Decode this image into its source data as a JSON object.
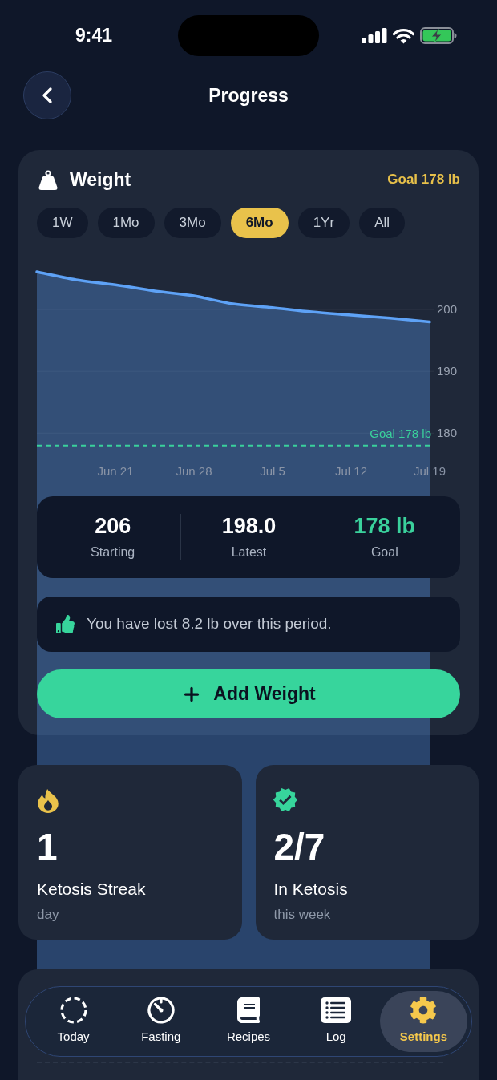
{
  "status_bar": {
    "time": "9:41"
  },
  "header": {
    "title": "Progress"
  },
  "weight_card": {
    "goal": "Goal 178 lb",
    "ranges": [
      {
        "label": "1W",
        "selected": false
      },
      {
        "label": "1Mo",
        "selected": false
      },
      {
        "label": "3Mo",
        "selected": false
      },
      {
        "label": "6Mo",
        "selected": true
      },
      {
        "label": "1Yr",
        "selected": false
      },
      {
        "label": "All",
        "selected": false
      }
    ],
    "chart_data": {
      "type": "area",
      "title": "Weight",
      "categories": [
        null,
        null,
        "Jun 21",
        null,
        "Jun 28",
        null,
        "Jul 5",
        null,
        "Jul 12",
        null,
        "Jul 19"
      ],
      "series": [
        {
          "type": "area",
          "color": "#5ea2f6",
          "values": [
            206.1,
            204.8,
            204.0,
            203.0,
            202.2,
            200.9,
            200.3,
            199.6,
            199.1,
            198.6,
            198.0
          ]
        }
      ],
      "ylim": [
        172,
        206.1
      ],
      "yticks": [
        180,
        190,
        200
      ],
      "grid": true,
      "ref_lines": [
        {
          "axis": "y",
          "value": 178,
          "label": "Goal 178 lb",
          "color": "#3ad19c"
        }
      ]
    },
    "stats": [
      {
        "value": "206",
        "label": "Starting",
        "kind": "value"
      },
      {
        "value": "198.0",
        "label": "Latest",
        "kind": "value"
      },
      {
        "value": "178 lb",
        "label": "Goal",
        "kind": "goal"
      }
    ],
    "message": "You have lost 8.2 lb over this period.",
    "add_button": {
      "label": "Add Weight"
    }
  },
  "summary_cards": [
    {
      "kind": "streak",
      "value": "1",
      "title": "Ketosis Streak",
      "caption": "day"
    },
    {
      "kind": "weekly",
      "value": "2/7",
      "title": "In Ketosis",
      "caption": "this week"
    }
  ],
  "tab_bar": [
    {
      "kind": "today",
      "label": "Today",
      "selected": false
    },
    {
      "kind": "fasting",
      "label": "Fasting",
      "selected": false
    },
    {
      "kind": "recipes",
      "label": "Recipes",
      "selected": false
    },
    {
      "kind": "log",
      "label": "Log",
      "selected": false
    },
    {
      "kind": "settings",
      "label": "Settings",
      "selected": true
    }
  ]
}
